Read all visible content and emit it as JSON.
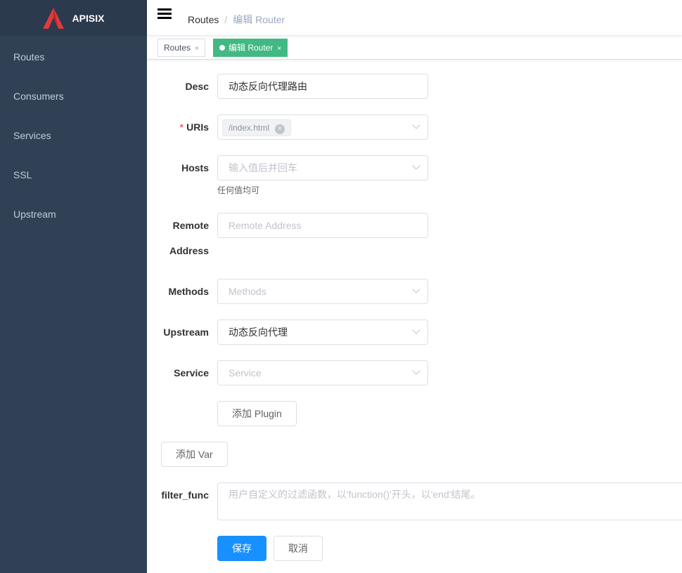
{
  "brand": {
    "name": "APISIX",
    "accent": "#e03a3e"
  },
  "sidebar": {
    "items": [
      {
        "label": "Routes"
      },
      {
        "label": "Consumers"
      },
      {
        "label": "Services"
      },
      {
        "label": "SSL"
      },
      {
        "label": "Upstream"
      }
    ]
  },
  "breadcrumb": {
    "root": "Routes",
    "separator": "/",
    "current": "编辑 Router"
  },
  "tags": [
    {
      "label": "Routes",
      "close": "×"
    },
    {
      "label": "编辑 Router",
      "close": "×"
    }
  ],
  "form": {
    "desc": {
      "label": "Desc",
      "value": "动态反向代理路由"
    },
    "uris": {
      "label": "URIs",
      "required": "*",
      "chips": [
        "/index.html"
      ],
      "chip_close": "×"
    },
    "hosts": {
      "label": "Hosts",
      "placeholder": "输入值后并回车",
      "help": "任何值均可"
    },
    "remote_address": {
      "label_line1": "Remote",
      "label_line2": "Address",
      "placeholder": "Remote Address"
    },
    "methods": {
      "label": "Methods",
      "placeholder": "Methods"
    },
    "upstream": {
      "label": "Upstream",
      "value": "动态反向代理"
    },
    "service": {
      "label": "Service",
      "placeholder": "Service"
    },
    "add_plugin": "添加 Plugin",
    "add_var": "添加 Var",
    "filter_func": {
      "label": "filter_func",
      "placeholder": "用户自定义的过滤函数，以'function()'开头，以'end'结尾。"
    },
    "save": "保存",
    "cancel": "取消"
  }
}
